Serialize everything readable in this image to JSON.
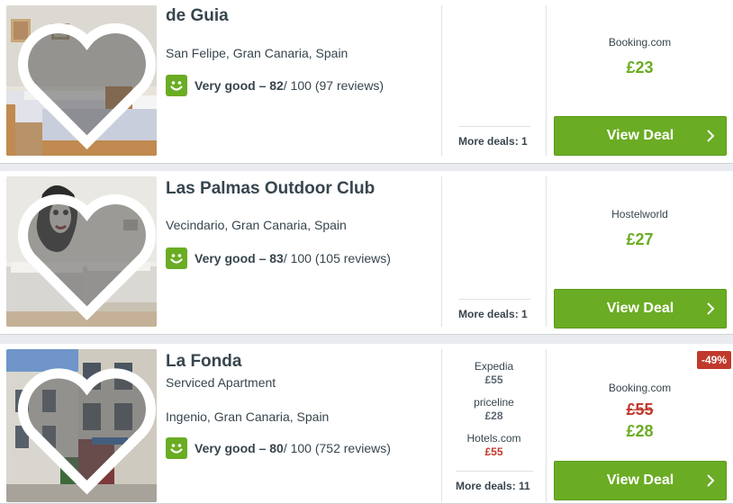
{
  "colors": {
    "accent_green": "#6aac23",
    "discount_red": "#c0392b",
    "text": "#37454d"
  },
  "hotels": [
    {
      "name": "de Guia",
      "subtype": "",
      "location": "San Felipe, Gran Canaria, Spain",
      "rating_label": "Very good – 82",
      "rating_rest": " / 100 (97 reviews)",
      "more_deals": "More deals: 1",
      "provider": "Booking.com",
      "price": "£23",
      "button": "View Deal"
    },
    {
      "name": "Las Palmas Outdoor Club",
      "subtype": "",
      "location": "Vecindario, Gran Canaria, Spain",
      "rating_label": "Very good – 83",
      "rating_rest": " / 100 (105 reviews)",
      "more_deals": "More deals: 1",
      "provider": "Hostelworld",
      "price": "£27",
      "button": "View Deal"
    },
    {
      "name": "La Fonda",
      "subtype": "Serviced Apartment",
      "location": "Ingenio, Gran Canaria, Spain",
      "rating_label": "Very good – 80",
      "rating_rest": " / 100 (752 reviews)",
      "more_deals": "More deals: 11",
      "alt_deals": [
        {
          "provider": "Expedia",
          "price": "£55"
        },
        {
          "provider": "priceline",
          "price": "£28"
        },
        {
          "provider": "Hotels.com",
          "price": "£55"
        }
      ],
      "provider": "Booking.com",
      "old_price": "£55",
      "price": "£28",
      "discount": "-49%",
      "button": "View Deal"
    }
  ]
}
